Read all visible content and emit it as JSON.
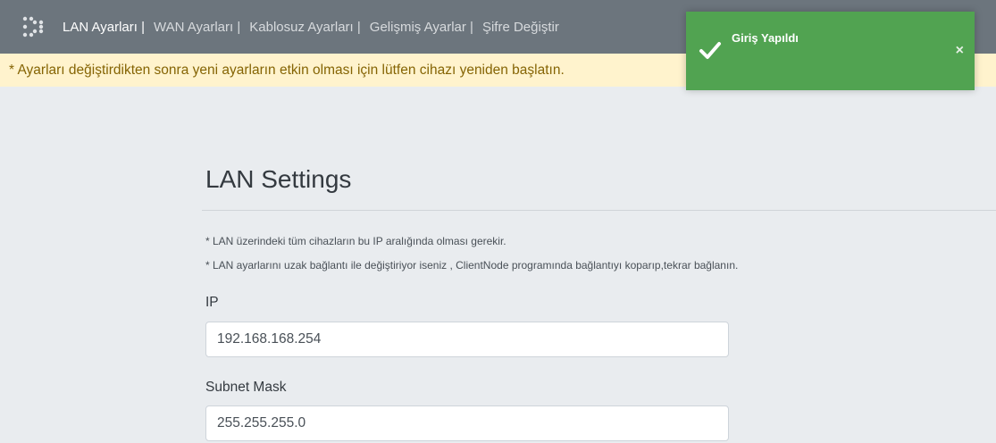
{
  "nav": {
    "brand_icon": "dots-grid-icon",
    "links": [
      {
        "label": "LAN Ayarları |"
      },
      {
        "label": "WAN Ayarları |"
      },
      {
        "label": "Kablosuz Ayarları |"
      },
      {
        "label": "Gelişmiş Ayarlar |"
      },
      {
        "label": "Şifre Değiştir"
      }
    ],
    "active_index": 0
  },
  "alert": {
    "text": "* Ayarları değiştirdikten sonra yeni ayarların etkin olması için lütfen cihazı yeniden başlatın."
  },
  "toast": {
    "title": "Giriş Yapıldı",
    "icon": "check-icon",
    "close": "×",
    "color": "#51a351"
  },
  "main": {
    "title": "LAN Settings",
    "notes": [
      "* LAN üzerindeki tüm cihazların bu IP aralığında olması gerekir.",
      "* LAN ayarlarını uzak bağlantı ile değiştiriyor iseniz , ClientNode programında bağlantıyı koparıp,tekrar bağlanın."
    ],
    "fields": {
      "ip": {
        "label": "IP",
        "value": "192.168.168.254"
      },
      "subnet": {
        "label": "Subnet Mask",
        "value": "255.255.255.0"
      }
    }
  },
  "colors": {
    "navbar": "#6c757d",
    "alert_bg": "#fff3cd",
    "alert_text": "#856404",
    "page_bg": "#e9ecef"
  }
}
